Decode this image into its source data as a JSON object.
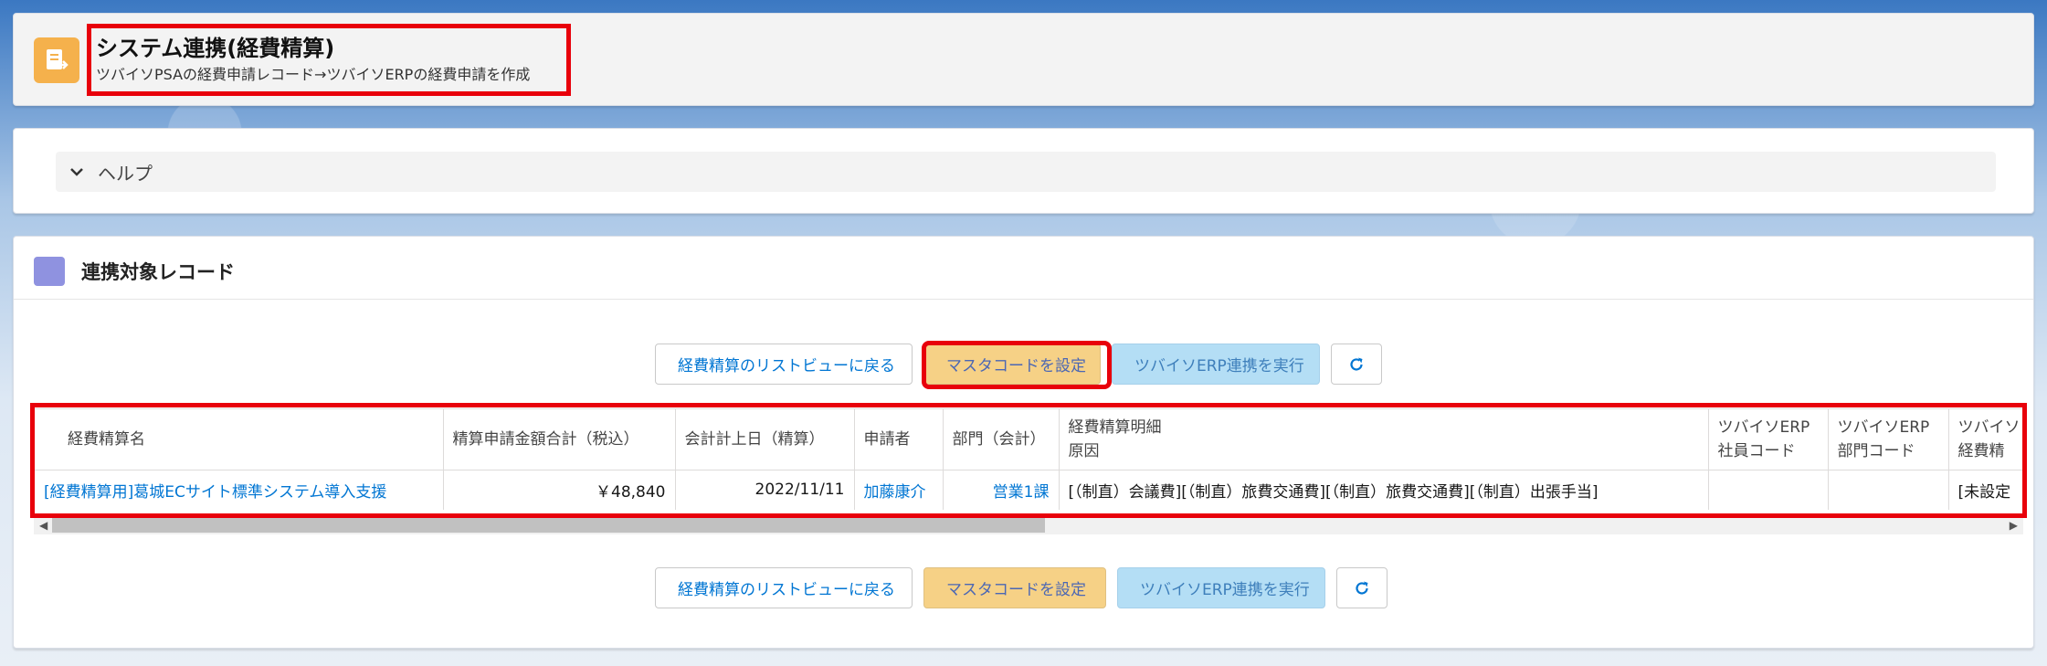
{
  "header": {
    "title": "システム連携(経費精算)",
    "subtitle": "ツバイソPSAの経費申請レコード→ツバイソERPの経費申請を作成",
    "icon": "document-export-icon"
  },
  "help": {
    "label": "ヘルプ",
    "icon": "chevron-down-icon"
  },
  "records": {
    "title": "連携対象レコード",
    "buttons": {
      "back_label": "経費精算のリストビューに戻る",
      "master_label": "マスタコードを設定",
      "erp_label": "ツバイソERP連携を実行",
      "refresh_icon": "refresh-icon"
    },
    "columns": [
      {
        "line1": "経費精算名",
        "line2": ""
      },
      {
        "line1": "精算申請金額合計（税込）",
        "line2": ""
      },
      {
        "line1": "会計計上日（精算）",
        "line2": ""
      },
      {
        "line1": "申請者",
        "line2": ""
      },
      {
        "line1": "部門（会計）",
        "line2": ""
      },
      {
        "line1": "経費精算明細",
        "line2": "原因"
      },
      {
        "line1": "ツバイソERP",
        "line2": "社員コード"
      },
      {
        "line1": "ツバイソERP",
        "line2": "部門コード"
      },
      {
        "line1": "ツバイソ",
        "line2": "経費精"
      }
    ],
    "rows": [
      {
        "name": "[経費精算用]葛城ECサイト標準システム導入支援",
        "amount": "￥48,840",
        "date": "2022/11/11",
        "applicant": "加藤康介",
        "department": "営業1課",
        "details": "[（制直）会議費][（制直）旅費交通費][（制直）旅費交通費][（制直）出張手当]",
        "emp_code": "",
        "dept_code": "",
        "expense": "[未設定"
      }
    ]
  },
  "colors": {
    "accent_red": "#e8000b",
    "header_icon": "#f5b14c",
    "records_icon": "#8f92e0",
    "master_button": "#f6d186",
    "erp_button": "#b4def5",
    "link": "#0176d3"
  }
}
